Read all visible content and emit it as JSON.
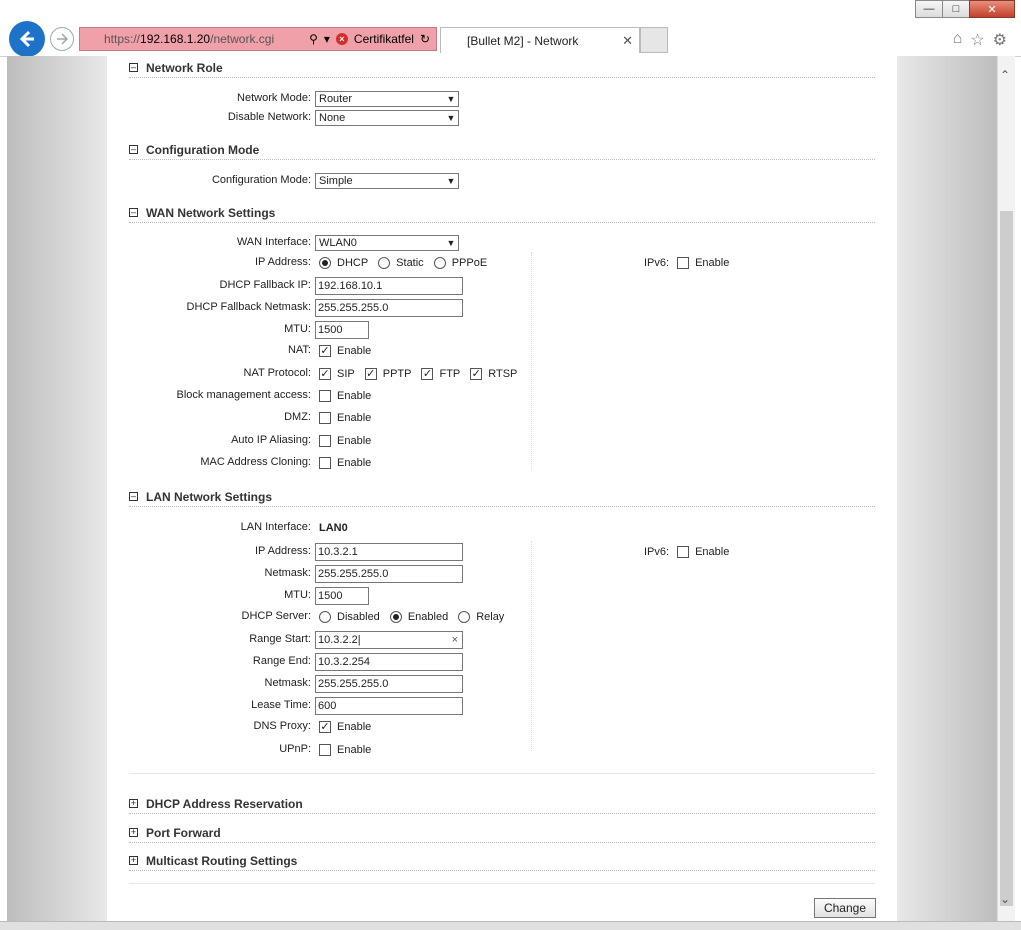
{
  "browser": {
    "url_prefix": "https://",
    "url_host": "192.168.1.20",
    "url_path": "/network.cgi",
    "cert_error": "Certifikatfel",
    "tab_title": "[Bullet M2] - Network"
  },
  "network_role": {
    "title": "Network Role",
    "network_mode_label": "Network Mode:",
    "network_mode_value": "Router",
    "disable_network_label": "Disable Network:",
    "disable_network_value": "None"
  },
  "config_mode": {
    "title": "Configuration Mode",
    "label": "Configuration Mode:",
    "value": "Simple"
  },
  "wan": {
    "title": "WAN Network Settings",
    "interface_label": "WAN Interface:",
    "interface_value": "WLAN0",
    "ip_label": "IP Address:",
    "ip_opt_dhcp": "DHCP",
    "ip_opt_static": "Static",
    "ip_opt_pppoe": "PPPoE",
    "ipv6_label": "IPv6:",
    "ipv6_enable": "Enable",
    "fallback_ip_label": "DHCP Fallback IP:",
    "fallback_ip_value": "192.168.10.1",
    "fallback_mask_label": "DHCP Fallback Netmask:",
    "fallback_mask_value": "255.255.255.0",
    "mtu_label": "MTU:",
    "mtu_value": "1500",
    "nat_label": "NAT:",
    "nat_enable": "Enable",
    "nat_protocol_label": "NAT Protocol:",
    "nat_sip": "SIP",
    "nat_pptp": "PPTP",
    "nat_ftp": "FTP",
    "nat_rtsp": "RTSP",
    "block_mgmt_label": "Block management access:",
    "block_mgmt_enable": "Enable",
    "dmz_label": "DMZ:",
    "dmz_enable": "Enable",
    "aliasing_label": "Auto IP Aliasing:",
    "aliasing_enable": "Enable",
    "mac_clone_label": "MAC Address Cloning:",
    "mac_clone_enable": "Enable"
  },
  "lan": {
    "title": "LAN Network Settings",
    "interface_label": "LAN Interface:",
    "interface_value": "LAN0",
    "ip_label": "IP Address:",
    "ip_value": "10.3.2.1",
    "ipv6_label": "IPv6:",
    "ipv6_enable": "Enable",
    "netmask_label": "Netmask:",
    "netmask_value": "255.255.255.0",
    "mtu_label": "MTU:",
    "mtu_value": "1500",
    "dhcp_label": "DHCP Server:",
    "dhcp_disabled": "Disabled",
    "dhcp_enabled": "Enabled",
    "dhcp_relay": "Relay",
    "range_start_label": "Range Start:",
    "range_start_value": "10.3.2.2",
    "range_end_label": "Range End:",
    "range_end_value": "10.3.2.254",
    "dhcp_netmask_label": "Netmask:",
    "dhcp_netmask_value": "255.255.255.0",
    "lease_label": "Lease Time:",
    "lease_value": "600",
    "dns_proxy_label": "DNS Proxy:",
    "dns_proxy_enable": "Enable",
    "upnp_label": "UPnP:",
    "upnp_enable": "Enable"
  },
  "collapsed": {
    "dhcp_reservation": "DHCP Address Reservation",
    "port_forward": "Port Forward",
    "multicast": "Multicast Routing Settings"
  },
  "change_button": "Change"
}
